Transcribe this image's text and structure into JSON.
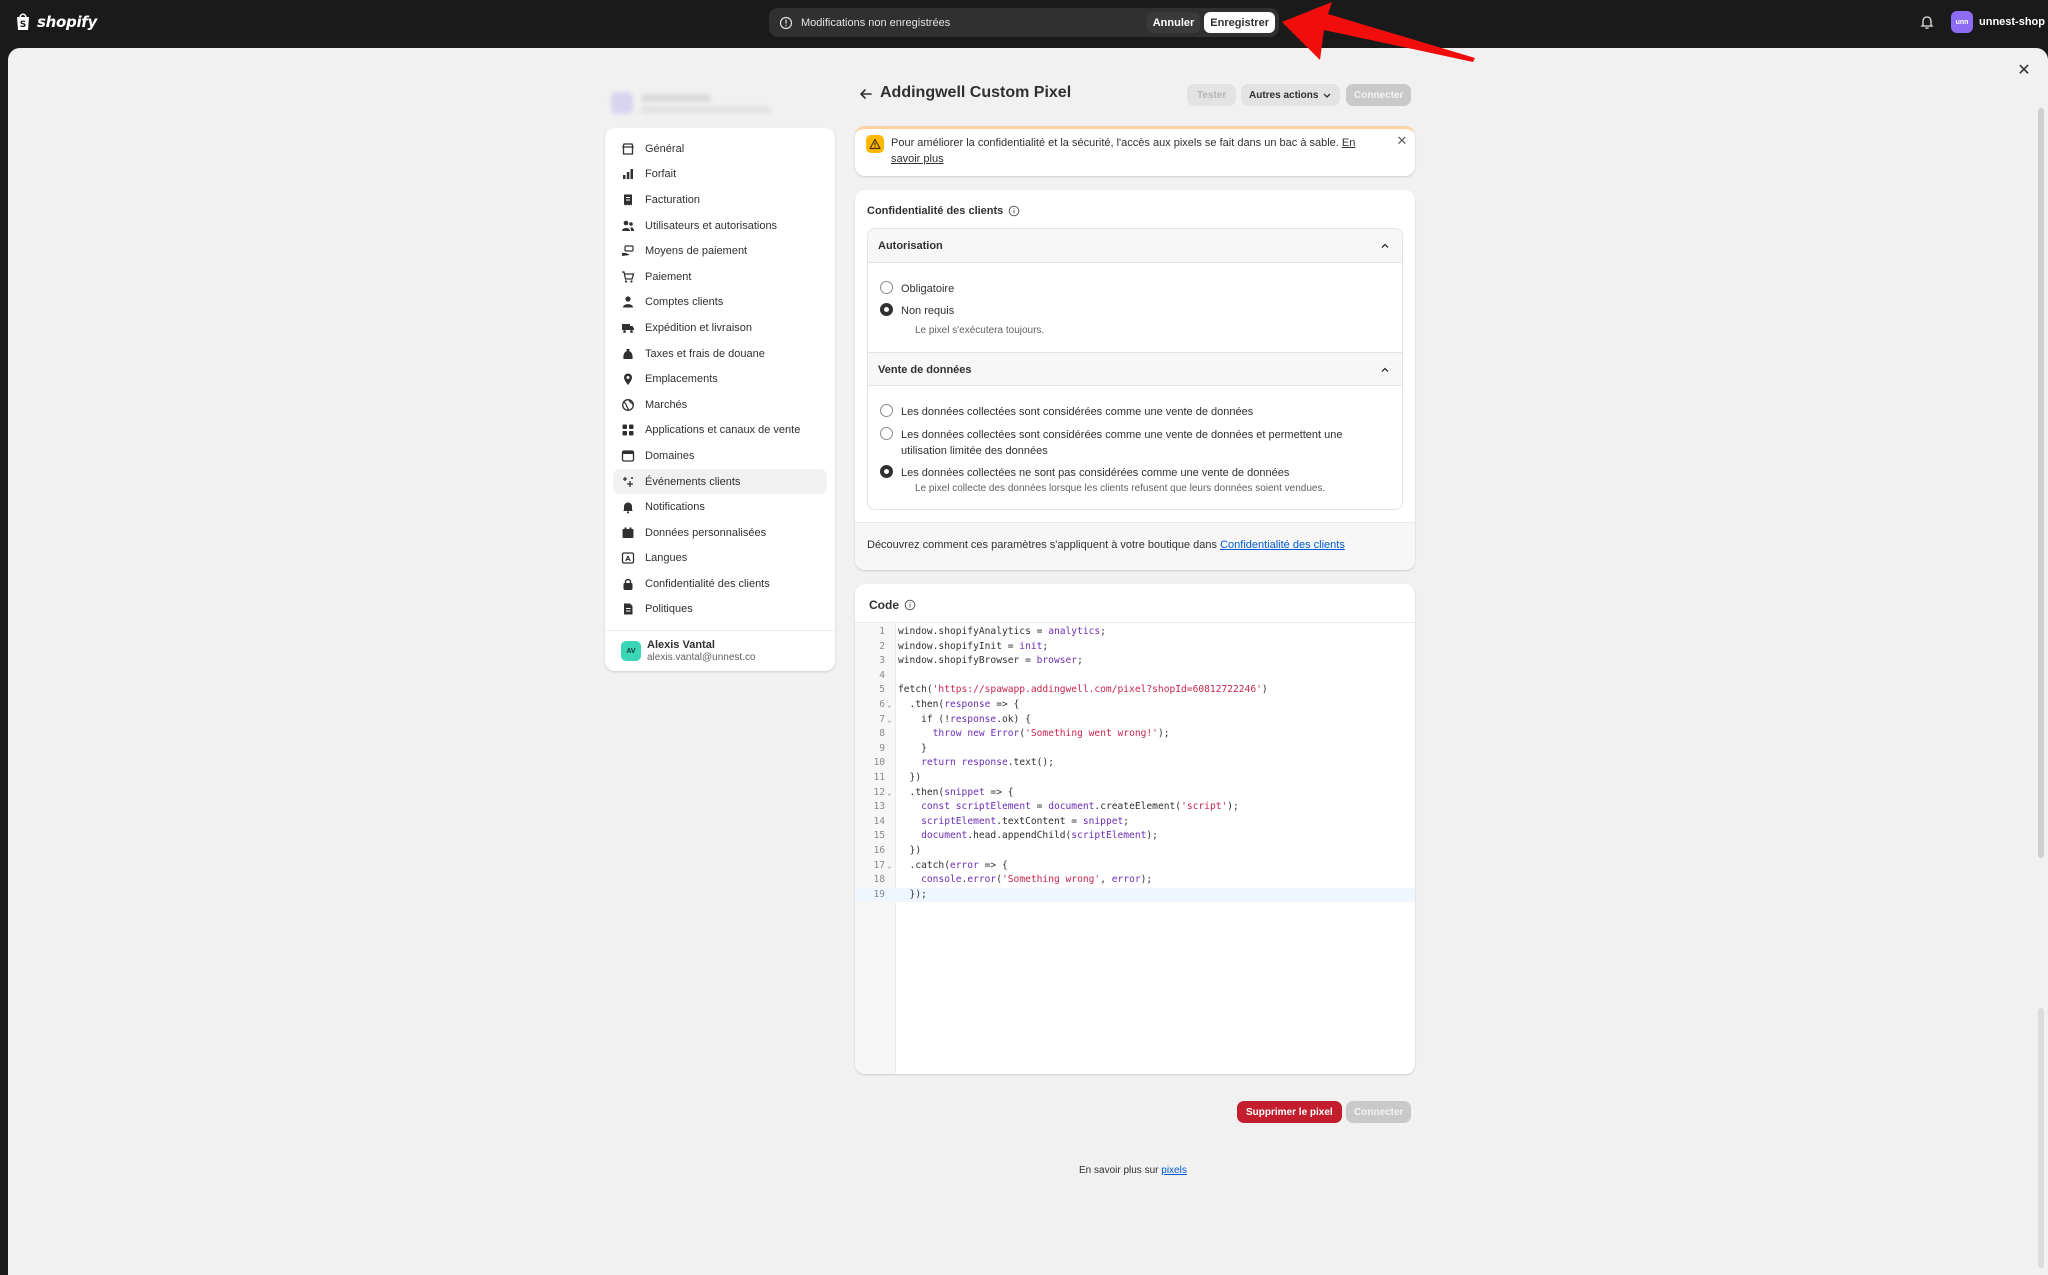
{
  "topbar": {
    "brand": "shopify",
    "unsaved_message": "Modifications non enregistrées",
    "cancel_label": "Annuler",
    "save_label": "Enregistrer",
    "shop_initials": "unn",
    "shop_name": "unnest-shop"
  },
  "header": {
    "title": "Addingwell Custom Pixel",
    "test_label": "Tester",
    "more_actions_label": "Autres actions",
    "connect_label": "Connecter"
  },
  "sidebar": {
    "items": [
      {
        "label": "Général",
        "icon": "store-icon"
      },
      {
        "label": "Forfait",
        "icon": "chart-icon"
      },
      {
        "label": "Facturation",
        "icon": "receipt-icon"
      },
      {
        "label": "Utilisateurs et autorisations",
        "icon": "users-icon"
      },
      {
        "label": "Moyens de paiement",
        "icon": "payment-hand-icon"
      },
      {
        "label": "Paiement",
        "icon": "cart-icon"
      },
      {
        "label": "Comptes clients",
        "icon": "person-icon"
      },
      {
        "label": "Expédition et livraison",
        "icon": "truck-icon"
      },
      {
        "label": "Taxes et frais de douane",
        "icon": "money-bag-icon"
      },
      {
        "label": "Emplacements",
        "icon": "location-icon"
      },
      {
        "label": "Marchés",
        "icon": "globe-icon"
      },
      {
        "label": "Applications et canaux de vente",
        "icon": "apps-icon"
      },
      {
        "label": "Domaines",
        "icon": "globe-window-icon"
      },
      {
        "label": "Événements clients",
        "icon": "sparkle-icon",
        "active": true
      },
      {
        "label": "Notifications",
        "icon": "bell-icon"
      },
      {
        "label": "Données personnalisées",
        "icon": "database-icon"
      },
      {
        "label": "Langues",
        "icon": "language-icon"
      },
      {
        "label": "Confidentialité des clients",
        "icon": "lock-icon"
      },
      {
        "label": "Politiques",
        "icon": "document-icon"
      }
    ],
    "user": {
      "initials": "AV",
      "name": "Alexis Vantal",
      "email": "alexis.vantal@unnest.co"
    }
  },
  "banner": {
    "text": "Pour améliorer la confidentialité et la sécurité, l'accès aux pixels se fait dans un bac à sable.",
    "link": "En savoir plus"
  },
  "privacy": {
    "title": "Confidentialité des clients",
    "authorization": {
      "title": "Autorisation",
      "options": [
        "Obligatoire",
        "Non requis"
      ],
      "selected": 1,
      "help": "Le pixel s'exécutera toujours."
    },
    "data_sale": {
      "title": "Vente de données",
      "options": [
        "Les données collectées sont considérées comme une vente de données",
        "Les données collectées sont considérées comme une vente de données et permettent une utilisation limitée des données",
        "Les données collectées ne sont pas considérées comme une vente de données"
      ],
      "selected": 2,
      "help": "Le pixel collecte des données lorsque les clients refusent que leurs données soient vendues."
    },
    "footer_text": "Découvrez comment ces paramètres s'appliquent à votre boutique dans",
    "footer_link": "Confidentialité des clients"
  },
  "code": {
    "title": "Code",
    "lines": [
      "window.shopifyAnalytics = analytics;",
      "window.shopifyInit = init;",
      "window.shopifyBrowser = browser;",
      "",
      "fetch('https://spawapp.addingwell.com/pixel?shopId=60812722246')",
      "  .then(response => {",
      "    if (!response.ok) {",
      "      throw new Error('Something went wrong!');",
      "    }",
      "    return response.text();",
      "  })",
      "  .then(snippet => {",
      "    const scriptElement = document.createElement('script');",
      "    scriptElement.textContent = snippet;",
      "    document.head.appendChild(scriptElement);",
      "  })",
      "  .catch(error => {",
      "    console.error('Something wrong', error);",
      "  });"
    ],
    "fold_lines": [
      6,
      7,
      12,
      17
    ],
    "current_line": 19
  },
  "footer": {
    "delete_label": "Supprimer le pixel",
    "connect_label": "Connecter",
    "learn_text": "En savoir plus sur",
    "learn_link": "pixels"
  }
}
